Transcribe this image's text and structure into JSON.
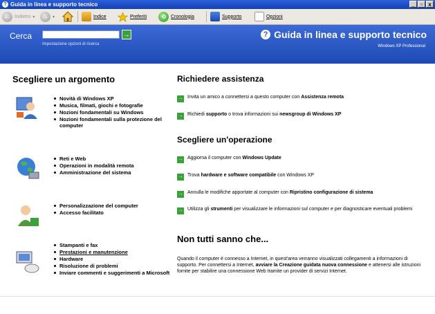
{
  "window": {
    "title": "Guida in linea e supporto tecnico",
    "min": "_",
    "max": "▫",
    "close": "x"
  },
  "toolbar": {
    "back": "Indietro",
    "index": "Indice",
    "favorites": "Preferiti",
    "history": "Cronologia",
    "support": "Supporto",
    "options": "Opzioni"
  },
  "search": {
    "label": "Cerca",
    "value": "",
    "options_link": "Impostazione opzioni di ricerca",
    "go": "→"
  },
  "header": {
    "title": "Guida in linea e supporto tecnico",
    "edition": "Windows XP Professional"
  },
  "left": {
    "title": "Scegliere un argomento",
    "groups": [
      {
        "icon": "person-media-icon",
        "items": [
          "Novità di Windows XP",
          "Musica, filmati, giochi e fotografie",
          "Nozioni fondamentali su Windows",
          "Nozioni fondamentali sulla protezione del computer"
        ]
      },
      {
        "icon": "globe-network-icon",
        "items": [
          "Reti e Web",
          "Operazioni in modalità remota",
          "Amministrazione del sistema"
        ]
      },
      {
        "icon": "user-accessibility-icon",
        "items": [
          "Personalizzazione del computer",
          "Accesso facilitato"
        ]
      },
      {
        "icon": "computer-tools-icon",
        "items": [
          "Stampanti e fax",
          "Prestazioni e manutenzione",
          "Hardware",
          "Risoluzione di problemi",
          "Inviare commenti e suggerimenti a Microsoft"
        ]
      }
    ]
  },
  "right": {
    "assist_title": "Richiedere assistenza",
    "assist": [
      {
        "pre": "Invita un amico a connettersi a questo computer con ",
        "bold": "Assistenza remota",
        "post": ""
      },
      {
        "pre": "Richiedi ",
        "bold": "supporto",
        "post": " o trova informazioni sui ",
        "bold2": "newsgroup di Windows XP"
      }
    ],
    "ops_title": "Scegliere un'operazione",
    "ops": [
      {
        "pre": "Aggiorna il computer con ",
        "bold": "Windows Update",
        "post": ""
      },
      {
        "pre": "Trova ",
        "bold": "hardware e software compatibile",
        "post": " con Windows XP"
      },
      {
        "pre": "Annulla le modifiche apportate al computer con ",
        "bold": "Ripristino configurazione di sistema",
        "post": ""
      },
      {
        "pre": "Utilizza gli ",
        "bold": "strumenti",
        "post": " per visualizzare le informazioni sul computer e per diagnosticare eventuali problemi"
      }
    ],
    "know_title": "Non tutti sanno che...",
    "know_text": {
      "p1": "Quando il computer è connesso a Internet, in quest'area verranno visualizzati collegamenti a informazioni di supporto. Per connettersi a Internet, ",
      "b1": "avviare la Creazione guidata nuova connessione",
      "p2": " e attenersi alle istruzioni fornite per stabilire una connessione Web tramite un provider di servizi Internet."
    }
  }
}
